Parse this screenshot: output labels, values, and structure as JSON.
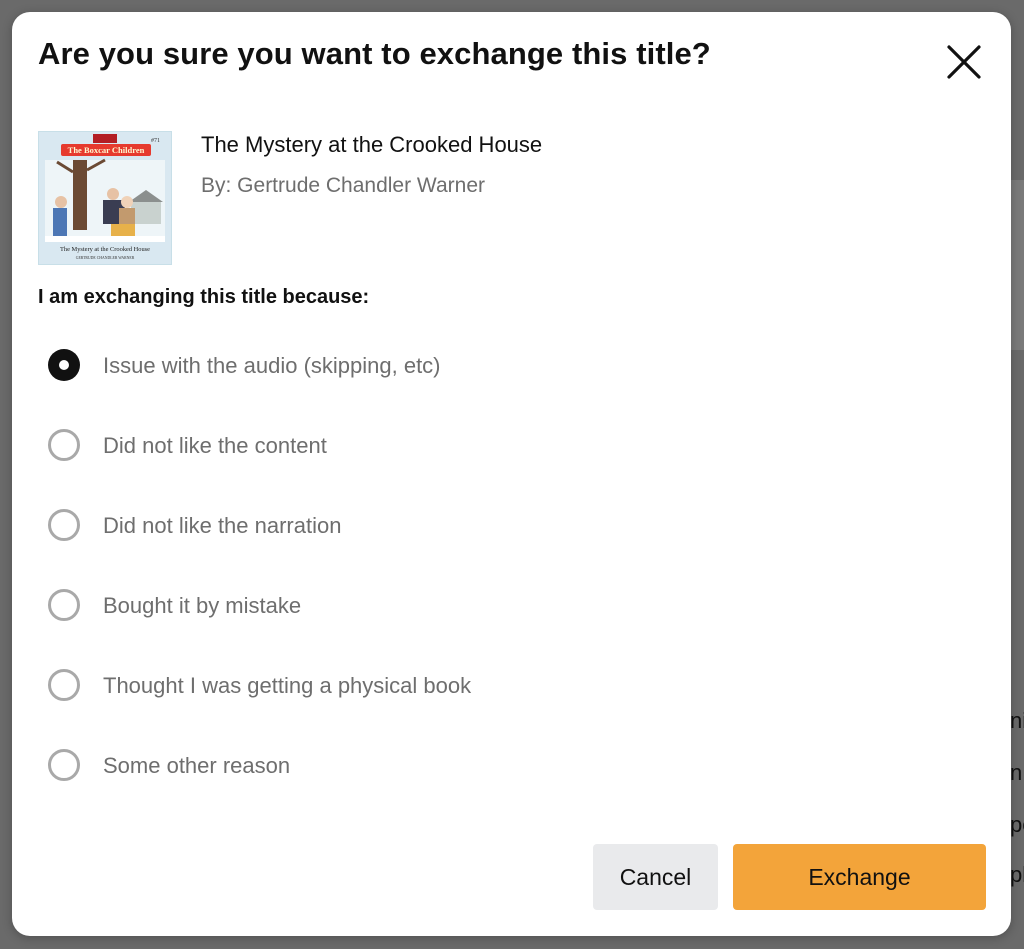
{
  "modal": {
    "title": "Are you sure you want to exchange this title?",
    "close_icon": "close-icon"
  },
  "book": {
    "title": "The Mystery at the Crooked House",
    "author": "By: Gertrude Chandler Warner",
    "cover": {
      "series": "The Boxcar Children",
      "number": "#71",
      "title": "The Mystery at the Crooked House",
      "creator": "GERTRUDE CHANDLER WARNER"
    }
  },
  "reason": {
    "heading": "I am exchanging this title because:",
    "selected_index": 0,
    "options": [
      "Issue with the audio (skipping, etc)",
      "Did not like the content",
      "Did not like the narration",
      "Bought it by mistake",
      "Thought I was getting a physical book",
      "Some other reason"
    ]
  },
  "buttons": {
    "cancel": "Cancel",
    "exchange": "Exchange"
  },
  "colors": {
    "accent": "#f3a43a",
    "cancel_bg": "#e9eaec",
    "overlay": "#5d5d5d"
  }
}
